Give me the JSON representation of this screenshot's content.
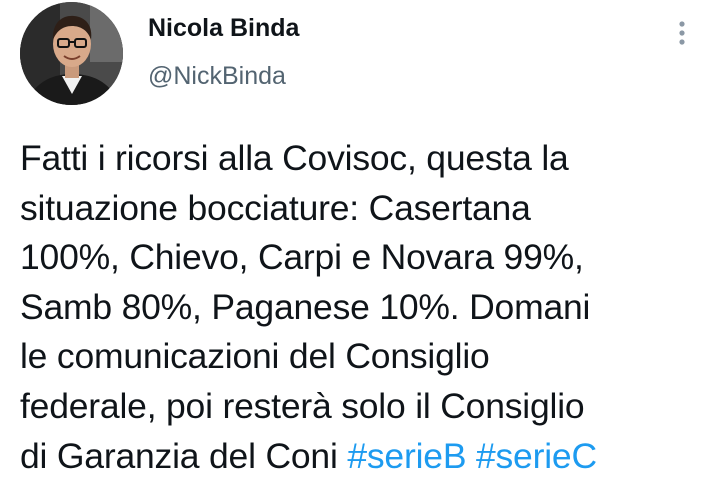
{
  "author": {
    "display_name": "Nicola Binda",
    "handle": "@NickBinda"
  },
  "tweet": {
    "lines": [
      "Fatti i ricorsi alla Covisoc, questa la",
      "situazione bocciature: Casertana",
      "100%, Chievo, Carpi e Novara 99%,",
      "Samb 80%, Paganese 10%. Domani",
      "le comunicazioni del Consiglio",
      "federale, poi resterà solo il Consiglio"
    ],
    "last_line_text": "di Garanzia del Coni",
    "hashtags": [
      "#serieB",
      "#serieC"
    ]
  },
  "icons": {
    "more": "more-vertical-icon",
    "avatar": "profile-photo"
  },
  "colors": {
    "text": "#0f1419",
    "secondary": "#536471",
    "link": "#1d9bf0",
    "background": "#ffffff"
  }
}
